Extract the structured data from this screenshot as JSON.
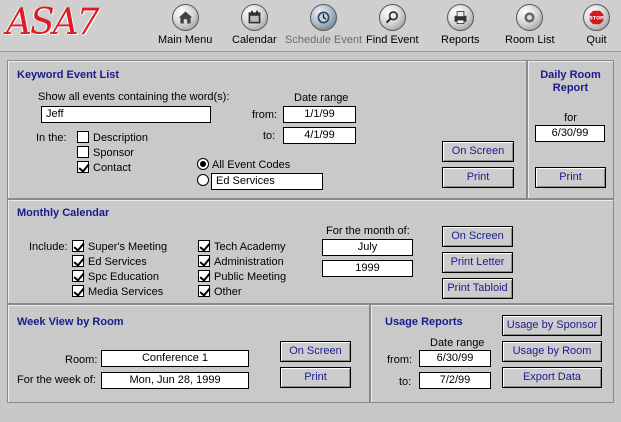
{
  "app": {
    "logo": "ASA7"
  },
  "toolbar": {
    "items": [
      {
        "label": "Main Menu",
        "icon": "house-icon"
      },
      {
        "label": "Calendar",
        "icon": "calendar-icon"
      },
      {
        "label": "Schedule Event",
        "icon": "clock-icon"
      },
      {
        "label": "Find Event",
        "icon": "magnifier-icon"
      },
      {
        "label": "Reports",
        "icon": "printer-icon"
      },
      {
        "label": "Room List",
        "icon": "list-icon"
      },
      {
        "label": "Quit",
        "icon": "stop-sign-icon"
      }
    ],
    "stop_text": "STOP"
  },
  "keyword": {
    "title": "Keyword Event List",
    "show_label": "Show all events containing the word(s):",
    "word_value": "Jeff",
    "date_range_label": "Date range",
    "from_label": "from:",
    "from_value": "1/1/99",
    "to_label": "to:",
    "to_value": "4/1/99",
    "in_the_label": "In the:",
    "fields": [
      {
        "label": "Description",
        "checked": false
      },
      {
        "label": "Sponsor",
        "checked": false
      },
      {
        "label": "Contact",
        "checked": true
      }
    ],
    "codes": {
      "all_label": "All Event Codes",
      "all_selected": true,
      "specific_value": "Ed Services"
    },
    "on_screen": "On Screen",
    "print": "Print"
  },
  "daily": {
    "title_line1": "Daily Room",
    "title_line2": "Report",
    "for_label": "for",
    "date_value": "6/30/99",
    "print": "Print"
  },
  "monthly": {
    "title": "Monthly Calendar",
    "include_label": "Include:",
    "left_items": [
      {
        "label": "Super's Meeting",
        "checked": true
      },
      {
        "label": "Ed Services",
        "checked": true
      },
      {
        "label": "Spc Education",
        "checked": true
      },
      {
        "label": "Media Services",
        "checked": true
      }
    ],
    "right_items": [
      {
        "label": "Tech Academy",
        "checked": true
      },
      {
        "label": "Administration",
        "checked": true
      },
      {
        "label": "Public Meeting",
        "checked": true
      },
      {
        "label": "Other",
        "checked": true
      }
    ],
    "month_label": "For the month of:",
    "month_value": "July",
    "year_value": "1999",
    "on_screen": "On Screen",
    "print_letter": "Print Letter",
    "print_tabloid": "Print Tabloid"
  },
  "week": {
    "title": "Week View by Room",
    "room_label": "Room:",
    "room_value": "Conference 1",
    "week_label": "For the week of:",
    "week_value": "Mon, Jun 28, 1999",
    "on_screen": "On Screen",
    "print": "Print"
  },
  "usage": {
    "title": "Usage Reports",
    "date_range_label": "Date range",
    "from_label": "from:",
    "from_value": "6/30/99",
    "to_label": "to:",
    "to_value": "7/2/99",
    "by_sponsor": "Usage by Sponsor",
    "by_room": "Usage by Room",
    "export": "Export Data"
  },
  "colors": {
    "accent_text": "#1a1a8c",
    "logo_red": "#d81f26",
    "panel_bg": "#c9c9c9"
  }
}
